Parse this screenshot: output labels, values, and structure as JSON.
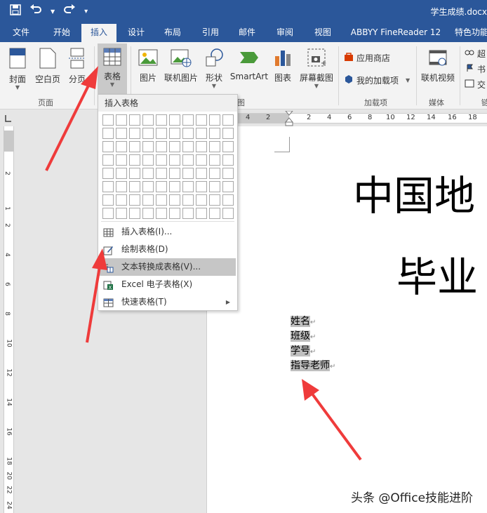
{
  "titlebar": {
    "doc_title": "学生成绩.docx",
    "save_icon": "save-icon",
    "undo_icon": "undo-icon",
    "redo_icon": "redo-icon",
    "customize_icon": "customize-icon"
  },
  "tabs": [
    "文件",
    "开始",
    "插入",
    "设计",
    "布局",
    "引用",
    "邮件",
    "审阅",
    "视图",
    "ABBYY FineReader 12",
    "特色功能"
  ],
  "active_tab": "插入",
  "ribbon": {
    "cover": "封面",
    "blank_page": "空白页",
    "page_break": "分页",
    "table": "表格",
    "picture": "图片",
    "online_picture": "联机图片",
    "shapes": "形状",
    "smartart": "SmartArt",
    "chart": "图表",
    "screenshot": "屏幕截图",
    "app_store": "应用商店",
    "my_addins": "我的加载项",
    "online_video": "联机视频",
    "link_partial_1": "超",
    "link_partial_2": "书",
    "link_partial_3": "交",
    "group_pages": "页面",
    "group_illustrations_partial": "图",
    "group_addins": "加载项",
    "group_media": "媒体",
    "group_links_partial": "链"
  },
  "table_menu": {
    "title": "插入表格",
    "items": [
      {
        "label": "插入表格(I)...",
        "icon": "insert-table-icon"
      },
      {
        "label": "绘制表格(D)",
        "icon": "draw-table-icon"
      },
      {
        "label": "文本转换成表格(V)...",
        "icon": "text-to-table-icon"
      },
      {
        "label": "Excel 电子表格(X)",
        "icon": "excel-icon"
      },
      {
        "label": "快速表格(T)",
        "icon": "quick-table-icon"
      }
    ],
    "highlighted": "文本转换成表格(V)..."
  },
  "hruler": [
    "4",
    "2",
    "2",
    "4",
    "6",
    "8",
    "10",
    "12",
    "14",
    "16",
    "18"
  ],
  "vruler": [
    "2",
    "1",
    "2",
    "4",
    "6",
    "8",
    "10",
    "12",
    "14",
    "16",
    "18",
    "20",
    "22",
    "24"
  ],
  "document": {
    "heading1": "中国地",
    "heading2": "毕业",
    "lines": [
      "姓名",
      "班级",
      "学号",
      "指导老师"
    ],
    "para_mark": "↵"
  },
  "watermark": "头条 @Office技能进阶",
  "colors": {
    "brand": "#2b579a",
    "arrow": "#ef3b3b",
    "highlight": "#c6c6c6"
  }
}
